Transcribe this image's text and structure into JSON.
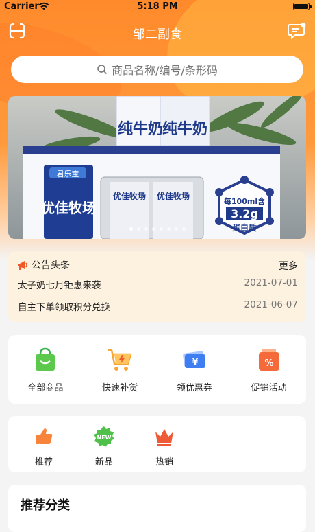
{
  "status_bar": {
    "carrier": "Carrier",
    "time": "5:18 PM"
  },
  "nav": {
    "title": "邹二副食"
  },
  "search": {
    "placeholder": "商品名称/编号/条形码"
  },
  "banner": {
    "slide_count": 8,
    "active_index": 0,
    "texts": {
      "milk_top": "纯牛奶",
      "brand_badge": "君乐宝",
      "box_name": "优佳牧场",
      "carton_name": "优佳牧场",
      "protein_line1": "每100ml含",
      "protein_value": "3.2g",
      "protein_line2": "蛋白质"
    }
  },
  "notice": {
    "title": "公告头条",
    "more": "更多",
    "items": [
      {
        "text": "太子奶七月钜惠来袭",
        "date": "2021-07-01"
      },
      {
        "text": "自主下单领取积分兑换",
        "date": "2021-06-07"
      }
    ]
  },
  "quick_menu": [
    {
      "label": "全部商品",
      "icon": "shopping-bag-icon"
    },
    {
      "label": "快速补货",
      "icon": "cart-icon"
    },
    {
      "label": "领优惠券",
      "icon": "coupon-icon"
    },
    {
      "label": "促销活动",
      "icon": "discount-icon"
    }
  ],
  "tags_menu": [
    {
      "label": "推荐",
      "icon": "thumbs-up-icon"
    },
    {
      "label": "新品",
      "icon": "new-badge-icon",
      "badge": "NEW"
    },
    {
      "label": "热销",
      "icon": "crown-icon"
    }
  ],
  "recommend_section": {
    "title": "推荐分类"
  },
  "colors": {
    "accent": "#ff8a2b",
    "notice_bg": "#fdf1e0"
  }
}
